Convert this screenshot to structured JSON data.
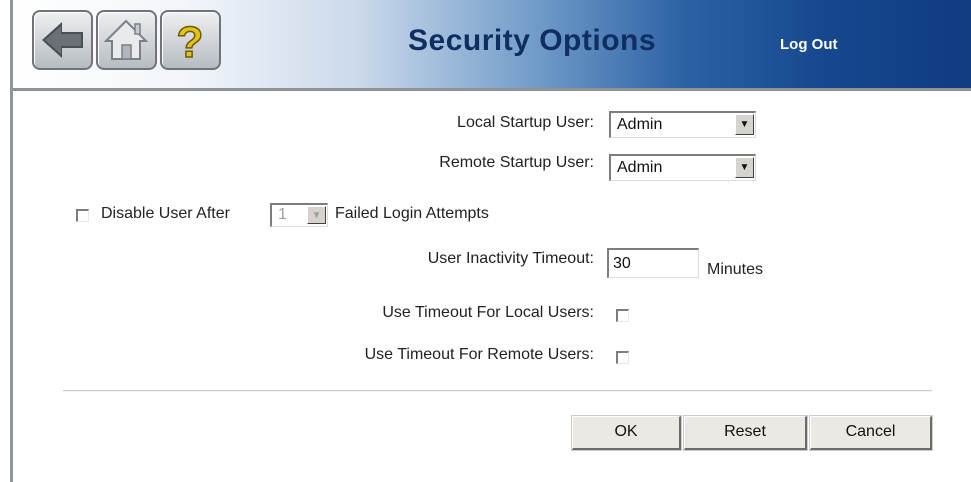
{
  "header": {
    "title": "Security Options",
    "logout_label": "Log Out",
    "icons": [
      "back-arrow-icon",
      "home-icon",
      "help-question-icon"
    ]
  },
  "form": {
    "local_startup_user": {
      "label": "Local Startup User:",
      "value": "Admin"
    },
    "remote_startup_user": {
      "label": "Remote Startup User:",
      "value": "Admin"
    },
    "disable_user": {
      "prefix": "Disable User After",
      "count_value": "1",
      "suffix": "Failed Login Attempts",
      "checked": false
    },
    "inactivity_timeout": {
      "label": "User Inactivity Timeout:",
      "value": "30",
      "unit": "Minutes"
    },
    "timeout_local": {
      "label": "Use Timeout For Local Users:",
      "checked": false
    },
    "timeout_remote": {
      "label": "Use Timeout For Remote Users:",
      "checked": false
    }
  },
  "buttons": {
    "ok": "OK",
    "reset": "Reset",
    "cancel": "Cancel"
  },
  "colors": {
    "header_dark": "#103c80",
    "title": "#0f2f63"
  }
}
